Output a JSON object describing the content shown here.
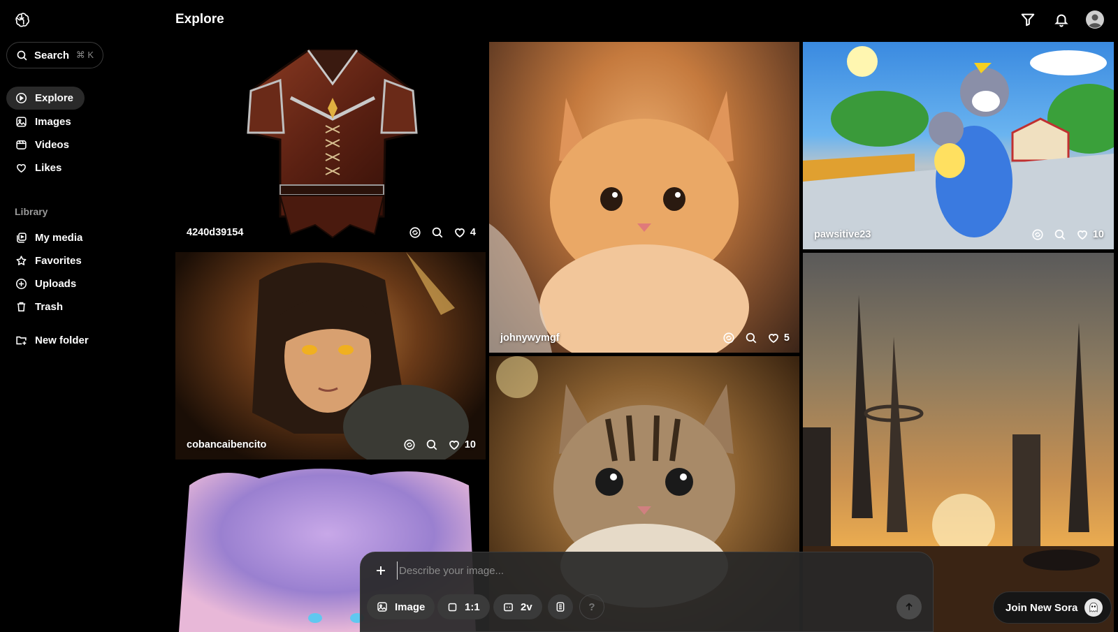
{
  "sidebar": {
    "logo": "openai-logo",
    "search": {
      "label": "Search",
      "shortcut": "⌘ K"
    },
    "nav": [
      {
        "label": "Explore",
        "icon": "explore-icon",
        "active": true
      },
      {
        "label": "Images",
        "icon": "image-icon"
      },
      {
        "label": "Videos",
        "icon": "video-icon"
      },
      {
        "label": "Likes",
        "icon": "heart-icon"
      }
    ],
    "library_label": "Library",
    "library": [
      {
        "label": "My media",
        "icon": "media-icon"
      },
      {
        "label": "Favorites",
        "icon": "star-icon"
      },
      {
        "label": "Uploads",
        "icon": "upload-icon"
      },
      {
        "label": "Trash",
        "icon": "trash-icon"
      }
    ],
    "new_folder": "New folder"
  },
  "header": {
    "title": "Explore",
    "icons": [
      "filter-icon",
      "bell-icon",
      "account-icon"
    ]
  },
  "cards": [
    {
      "user": "4240d39154",
      "likes": "4",
      "subject": "leather armor"
    },
    {
      "user": "johnywymgf",
      "likes": "5",
      "subject": "orange kitten"
    },
    {
      "user": "pawsitive23",
      "likes": "10",
      "subject": "cartoon cats"
    },
    {
      "user": "cobancaibencito",
      "likes": "10",
      "subject": "anime warrior"
    },
    {
      "user": "",
      "likes": "",
      "subject": "tabby kitten"
    },
    {
      "user": "",
      "likes": "",
      "subject": "futuristic city"
    },
    {
      "user": "",
      "likes": "",
      "subject": "watercolor cat"
    }
  ],
  "composer": {
    "placeholder": "Describe your image...",
    "type_label": "Image",
    "ratio_label": "1:1",
    "variations_label": "2v",
    "help_label": "?"
  },
  "join_label": "Join New Sora",
  "colors": {
    "background": "#000000",
    "active_nav": "#2a2a2a",
    "composer": "#282828"
  }
}
